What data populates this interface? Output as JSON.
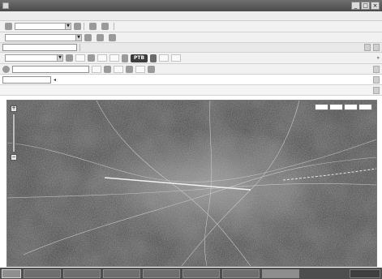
{
  "window": {
    "title": ""
  },
  "menubar": {
    "items": []
  },
  "toolbar1": {
    "labels": [
      "",
      "",
      "",
      "",
      "",
      ""
    ]
  },
  "toolbar2": {
    "labels": [
      "",
      "",
      "",
      "",
      ""
    ]
  },
  "toolbar3": {
    "pills": [
      "",
      "PTB",
      ""
    ]
  },
  "address": {
    "value": ""
  },
  "tab": {
    "label": ""
  },
  "map": {
    "view_tabs": [
      "",
      "",
      "",
      ""
    ],
    "zoom": {
      "plus": "+",
      "minus": "−"
    }
  },
  "taskbar": {
    "start_label": "",
    "buttons": [
      "",
      "",
      "",
      "",
      "",
      "",
      ""
    ]
  }
}
